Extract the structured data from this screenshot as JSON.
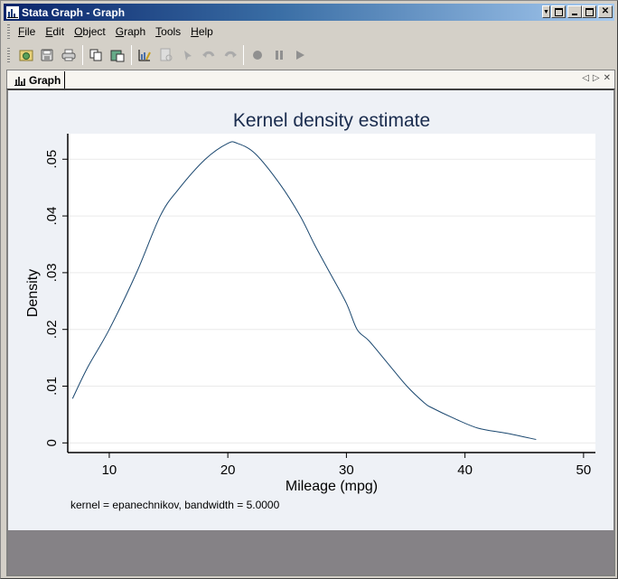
{
  "window": {
    "title": "Stata Graph - Graph",
    "controls": [
      "menu-dropdown",
      "restore-docked",
      "minimize",
      "maximize",
      "close"
    ]
  },
  "menubar": {
    "items": [
      {
        "label": "File",
        "accel": "F"
      },
      {
        "label": "Edit",
        "accel": "E"
      },
      {
        "label": "Object",
        "accel": "O"
      },
      {
        "label": "Graph",
        "accel": "G"
      },
      {
        "label": "Tools",
        "accel": "T"
      },
      {
        "label": "Help",
        "accel": "H"
      }
    ]
  },
  "toolbar": {
    "groups": [
      [
        "open-icon",
        "save-icon",
        "print-icon"
      ],
      [
        "copy-icon",
        "rename-icon"
      ],
      [
        "graph-editor-icon",
        "object-browser-icon",
        "add-object-icon",
        "undo-icon",
        "redo-icon"
      ],
      [
        "record-icon",
        "pause-icon",
        "play-icon"
      ]
    ]
  },
  "tabs": [
    {
      "label": "Graph",
      "active": true
    }
  ],
  "tab_nav": {
    "prev": "◁",
    "next": "▷",
    "close": "✕"
  },
  "colors": {
    "line": "#1a476f",
    "graph_bg": "#eef1f6",
    "plot_bg": "#ffffff",
    "gridline": "#eaeaea",
    "title": "#1a2c4e",
    "footer_bg": "#858286"
  },
  "chart_data": {
    "type": "line",
    "title": "Kernel density estimate",
    "xlabel": "Mileage (mpg)",
    "ylabel": "Density",
    "note": "kernel = epanechnikov, bandwidth = 5.0000",
    "xlim": [
      6.5,
      51
    ],
    "ylim": [
      -0.0017,
      0.0545
    ],
    "xticks": [
      10,
      20,
      30,
      40,
      50
    ],
    "xtick_labels": [
      "10",
      "20",
      "30",
      "40",
      "50"
    ],
    "yticks": [
      0,
      0.01,
      0.02,
      0.03,
      0.04,
      0.05
    ],
    "ytick_labels": [
      "0",
      ".01",
      ".02",
      ".03",
      ".04",
      ".05"
    ],
    "grid": "horizontal",
    "legend": "none",
    "series": [
      {
        "name": "density",
        "x": [
          6.9,
          8.2,
          10.0,
          12.3,
          14.3,
          15.8,
          18.1,
          20.0,
          20.8,
          22.3,
          24.4,
          26.1,
          27.3,
          28.6,
          30.0,
          30.9,
          31.9,
          33.5,
          35.1,
          36.6,
          37.2,
          39.0,
          41.1,
          43.5,
          46.0
        ],
        "y": [
          0.0078,
          0.0134,
          0.02,
          0.03,
          0.04,
          0.0446,
          0.05,
          0.0528,
          0.0528,
          0.051,
          0.0456,
          0.04,
          0.035,
          0.03,
          0.0246,
          0.02,
          0.018,
          0.014,
          0.01,
          0.007,
          0.0062,
          0.0044,
          0.0026,
          0.0017,
          0.0006
        ]
      }
    ]
  }
}
